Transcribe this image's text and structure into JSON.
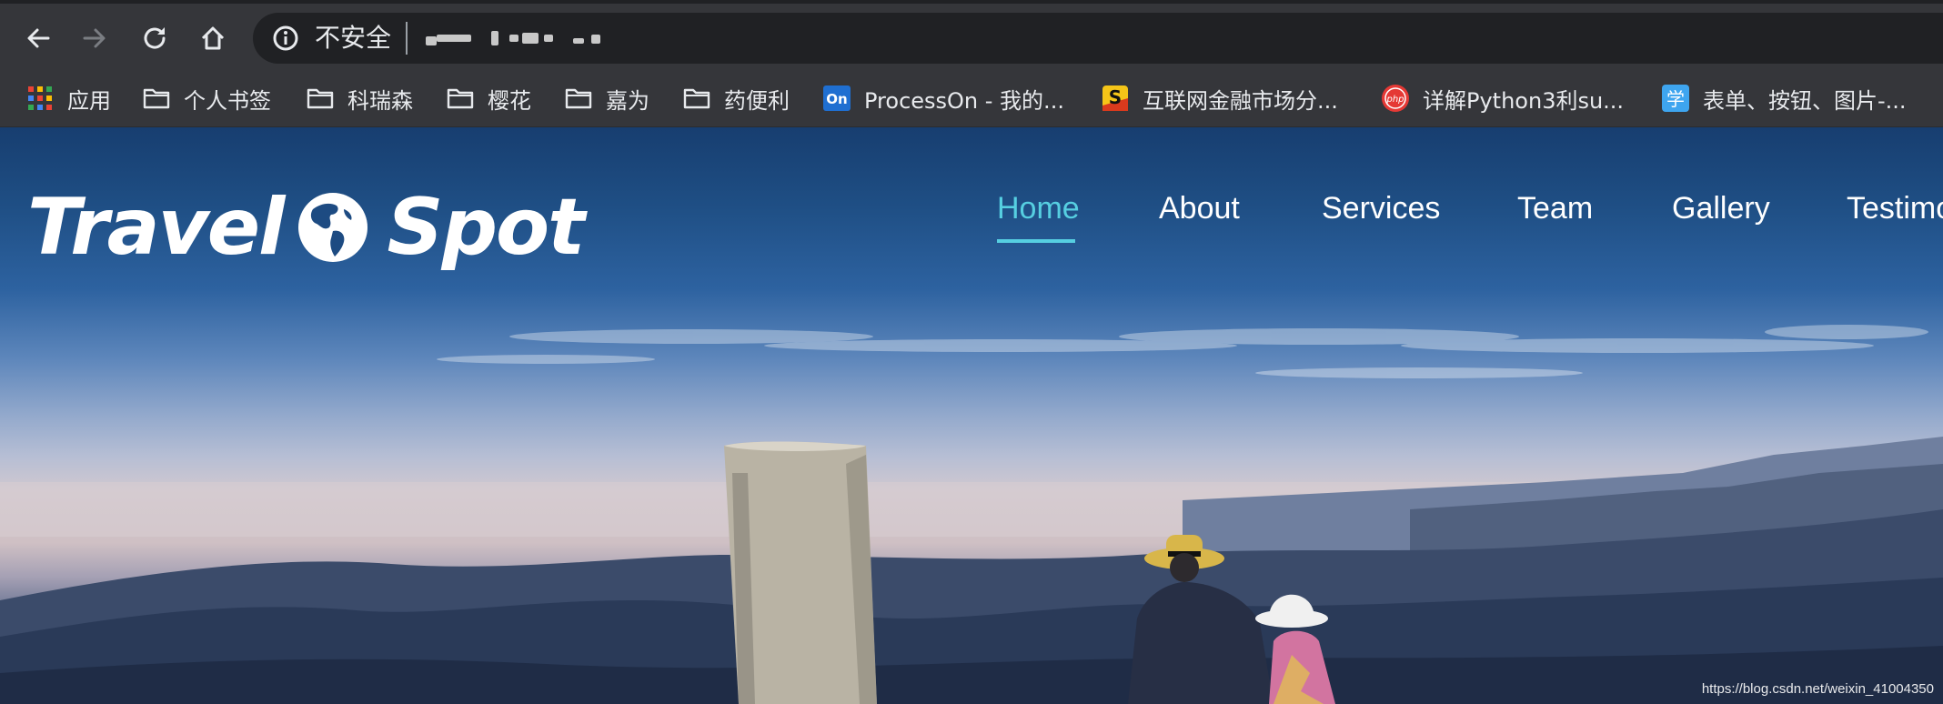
{
  "browser": {
    "security_label": "不安全",
    "icons": [
      "back-arrow-icon",
      "forward-arrow-icon",
      "reload-icon",
      "home-icon",
      "info-icon"
    ]
  },
  "bookmarks": [
    {
      "label": "应用",
      "icon": "apps-grid-icon"
    },
    {
      "label": "个人书签",
      "icon": "folder-icon"
    },
    {
      "label": "科瑞森",
      "icon": "folder-icon"
    },
    {
      "label": "樱花",
      "icon": "folder-icon"
    },
    {
      "label": "嘉为",
      "icon": "folder-icon"
    },
    {
      "label": "药便利",
      "icon": "folder-icon"
    },
    {
      "label": "ProcessOn - 我的...",
      "icon": "processon-icon"
    },
    {
      "label": "互联网金融市场分...",
      "icon": "s-site-icon"
    },
    {
      "label": "详解Python3利su...",
      "icon": "php-icon"
    },
    {
      "label": "表单、按钮、图片-...",
      "icon": "xue-icon"
    }
  ],
  "site": {
    "logo_left": "Travel",
    "logo_right": "Spot",
    "nav": [
      {
        "label": "Home",
        "active": true
      },
      {
        "label": "About",
        "active": false
      },
      {
        "label": "Services",
        "active": false
      },
      {
        "label": "Team",
        "active": false
      },
      {
        "label": "Gallery",
        "active": false
      },
      {
        "label": "Testimo",
        "active": false
      }
    ],
    "accent_color": "#56cfe1"
  },
  "watermark": "https://blog.csdn.net/weixin_41004350"
}
